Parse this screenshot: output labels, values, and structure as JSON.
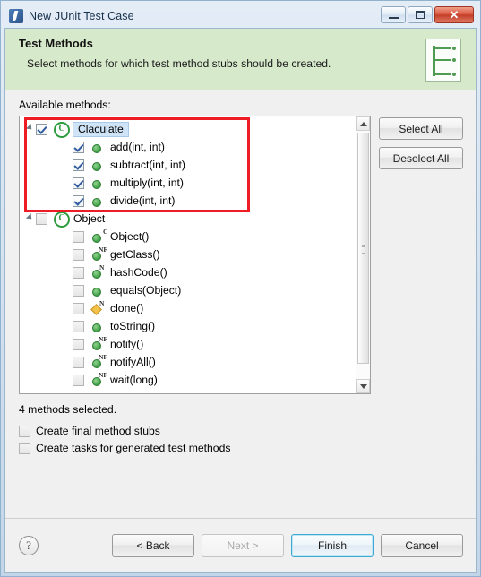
{
  "window": {
    "title": "New JUnit Test Case",
    "icon": "junit-icon",
    "controls": {
      "minimize": "minimize-icon",
      "maximize": "maximize-icon",
      "close": "✕"
    }
  },
  "banner": {
    "title": "Test Methods",
    "description": "Select methods for which test method stubs should be created.",
    "icon": "test-methods-wizard-icon",
    "accent_color": "#d6e9cb"
  },
  "body": {
    "available_label": "Available methods:",
    "selection_note": "4 methods selected.",
    "side_buttons": [
      {
        "label": "Select All",
        "name": "select-all-button"
      },
      {
        "label": "Deselect All",
        "name": "deselect-all-button"
      }
    ],
    "options": [
      {
        "label": "Create final method stubs",
        "checked": false
      },
      {
        "label": "Create tasks for generated test methods",
        "checked": false
      }
    ]
  },
  "tree": {
    "nodes": [
      {
        "label": "Claculate",
        "level": 0,
        "checked": true,
        "expanded": true,
        "selected": true,
        "icon": "java-class-icon",
        "badge": ""
      },
      {
        "label": "add(int, int)",
        "level": 1,
        "checked": true,
        "icon": "method-public-icon",
        "badge": ""
      },
      {
        "label": "subtract(int, int)",
        "level": 1,
        "checked": true,
        "icon": "method-public-icon",
        "badge": ""
      },
      {
        "label": "multiply(int, int)",
        "level": 1,
        "checked": true,
        "icon": "method-public-icon",
        "badge": ""
      },
      {
        "label": "divide(int, int)",
        "level": 1,
        "checked": true,
        "icon": "method-public-icon",
        "badge": ""
      },
      {
        "label": "Object",
        "level": 0,
        "checked": false,
        "expanded": true,
        "selected": false,
        "icon": "java-class-icon",
        "badge": ""
      },
      {
        "label": "Object()",
        "level": 1,
        "checked": false,
        "icon": "method-public-icon",
        "badge": "C"
      },
      {
        "label": "getClass()",
        "level": 1,
        "checked": false,
        "icon": "method-public-icon",
        "badge": "NF"
      },
      {
        "label": "hashCode()",
        "level": 1,
        "checked": false,
        "icon": "method-public-icon",
        "badge": "N"
      },
      {
        "label": "equals(Object)",
        "level": 1,
        "checked": false,
        "icon": "method-public-icon",
        "badge": ""
      },
      {
        "label": "clone()",
        "level": 1,
        "checked": false,
        "icon": "method-protected-icon",
        "badge": "N"
      },
      {
        "label": "toString()",
        "level": 1,
        "checked": false,
        "icon": "method-public-icon",
        "badge": ""
      },
      {
        "label": "notify()",
        "level": 1,
        "checked": false,
        "icon": "method-public-icon",
        "badge": "NF"
      },
      {
        "label": "notifyAll()",
        "level": 1,
        "checked": false,
        "icon": "method-public-icon",
        "badge": "NF"
      },
      {
        "label": "wait(long)",
        "level": 1,
        "checked": false,
        "icon": "method-public-icon",
        "badge": "NF"
      }
    ],
    "scrollbar": {
      "up": "scroll-up-icon",
      "down": "scroll-down-icon"
    }
  },
  "footer": {
    "help": "?",
    "buttons": [
      {
        "label": "< Back",
        "name": "back-button",
        "state": "enabled"
      },
      {
        "label": "Next >",
        "name": "next-button",
        "state": "disabled"
      },
      {
        "label": "Finish",
        "name": "finish-button",
        "state": "default"
      },
      {
        "label": "Cancel",
        "name": "cancel-button",
        "state": "enabled"
      }
    ]
  },
  "annotation": {
    "color": "#ee1c25",
    "shape": "rectangle"
  }
}
